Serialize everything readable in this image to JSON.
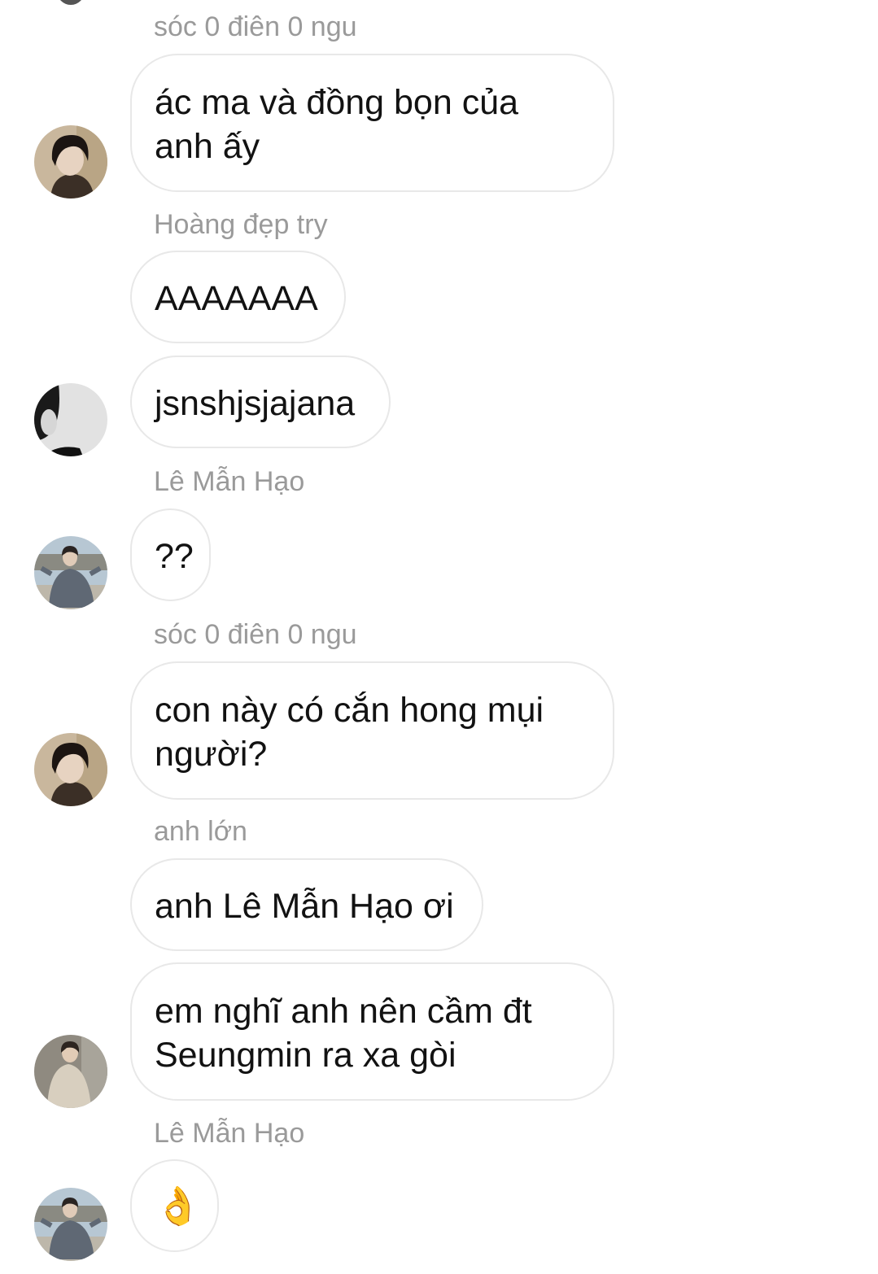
{
  "thread": {
    "messages": [
      {
        "sender": "sóc 0 điên 0 ngu",
        "texts": [
          "ác ma và đồng bọn của\nanh ấy"
        ],
        "avatar": "avatar-dark-hair-portrait"
      },
      {
        "sender": "Hoàng đẹp try",
        "texts": [
          "AAAAAAA",
          "jsnshjsjajana"
        ],
        "avatar": "avatar-grayscale-portrait"
      },
      {
        "sender": "Lê Mẫn Hạo",
        "texts": [
          "??"
        ],
        "avatar": "avatar-street-photo"
      },
      {
        "sender": "sóc 0 điên 0 ngu",
        "texts": [
          "con này có cắn hong mụi\nngười?"
        ],
        "avatar": "avatar-dark-hair-portrait"
      },
      {
        "sender": "anh lớn",
        "texts": [
          "anh Lê Mẫn Hạo ơi",
          "em nghĩ anh nên cầm đt\nSeungmin ra xa gòi"
        ],
        "avatar": "avatar-outdoor-photo"
      },
      {
        "sender": "Lê Mẫn Hạo",
        "texts": [
          "👌"
        ],
        "avatar": "avatar-street-photo"
      }
    ]
  },
  "colors": {
    "background": "#ffffff",
    "sender_name": "#9a9a9a",
    "bubble_border": "#e8e8e8",
    "message_text": "#121212"
  }
}
